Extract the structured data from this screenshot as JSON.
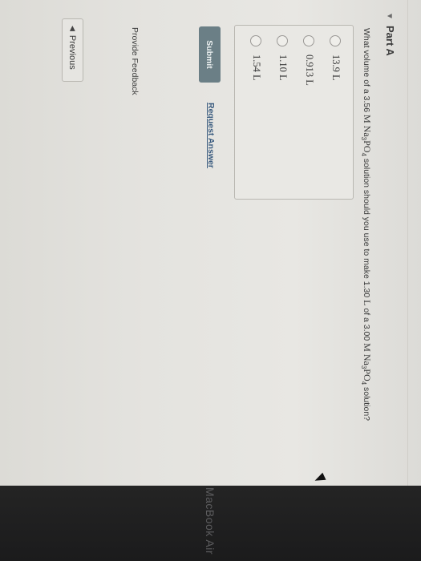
{
  "part": {
    "title": "Part A"
  },
  "question": {
    "t1": "What volume of a 3.56 ",
    "c1": "M Na",
    "s1": "3",
    "c2": "PO",
    "s2": "4",
    "t2": " solution should you use to make 1.30 ",
    "c3": "L",
    "t3": " of a 3.00 ",
    "c4": "M Na",
    "s3": "3",
    "c5": "PO",
    "s4": "4",
    "t4": " solution?"
  },
  "options": [
    "13.9 L",
    "0.913 L",
    "1.10 L",
    "1.54 L"
  ],
  "buttons": {
    "submit": "Submit",
    "request_answer": "Request Answer",
    "previous": "Previous"
  },
  "links": {
    "feedback": "Provide Feedback"
  },
  "device": {
    "brand": "MacBook Air"
  }
}
